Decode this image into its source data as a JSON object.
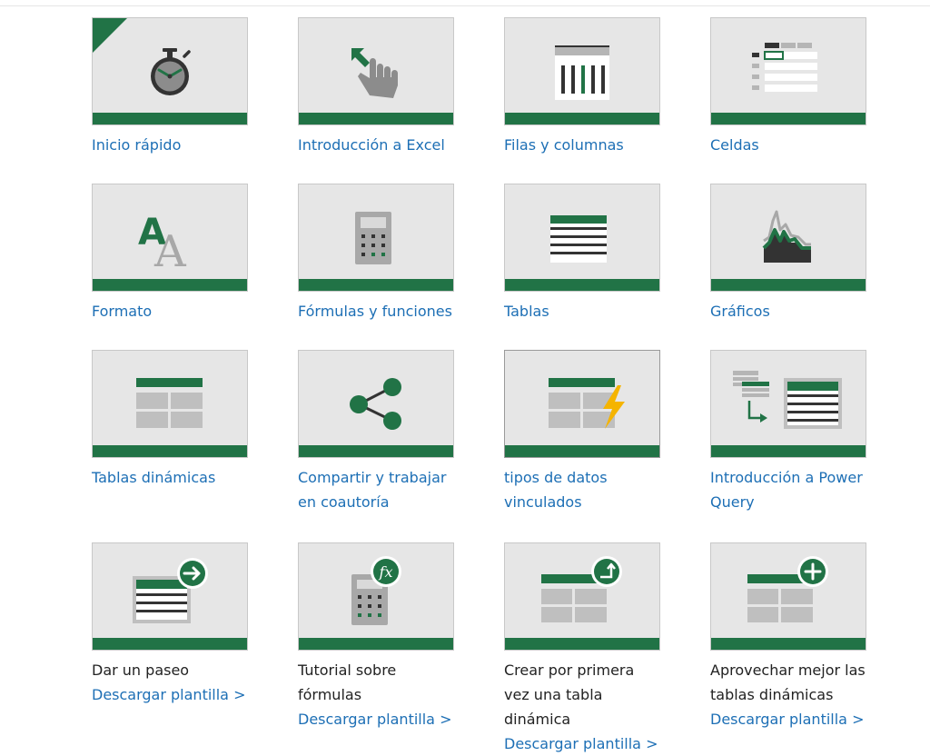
{
  "colors": {
    "accent": "#217346",
    "link": "#1d6fb5",
    "tile_bg": "#e6e6e6"
  },
  "tiles": [
    {
      "label": "Inicio rápido",
      "icon": "stopwatch-icon"
    },
    {
      "label": "Introducción a Excel",
      "icon": "pointer-hand-icon"
    },
    {
      "label": "Filas y columnas",
      "icon": "columns-icon"
    },
    {
      "label": "Celdas",
      "icon": "cells-icon"
    },
    {
      "label": "Formato",
      "icon": "font-format-icon"
    },
    {
      "label": "Fórmulas y funciones",
      "icon": "calculator-icon"
    },
    {
      "label": "Tablas",
      "icon": "table-icon"
    },
    {
      "label": "Gráficos",
      "icon": "chart-icon"
    },
    {
      "label": "Tablas dinámicas",
      "icon": "pivot-table-icon"
    },
    {
      "label": "Compartir y trabajar en coautoría",
      "icon": "share-icon"
    },
    {
      "label": "tipos de datos vinculados",
      "icon": "linked-data-icon"
    },
    {
      "label": "Introducción a Power Query",
      "icon": "power-query-icon"
    },
    {
      "label": "Dar un paseo",
      "icon": "tour-arrow-icon",
      "link": "Descargar plantilla >"
    },
    {
      "label": "Tutorial sobre fórmulas",
      "icon": "fx-calculator-icon",
      "link": "Descargar plantilla >"
    },
    {
      "label": "Crear por primera vez una tabla dinámica",
      "icon": "pivot-return-icon",
      "link": "Descargar plantilla >"
    },
    {
      "label": "Aprovechar mejor las tablas dinámicas",
      "icon": "pivot-plus-icon",
      "link": "Descargar plantilla >"
    }
  ]
}
